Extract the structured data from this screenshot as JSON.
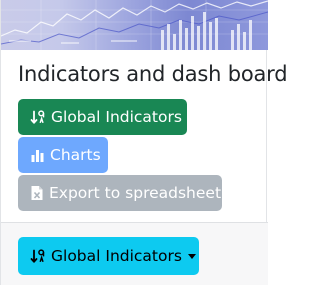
{
  "banner": {
    "image": "stock-market-banner"
  },
  "card": {
    "title": "Indicators and dash board",
    "buttons": {
      "global_indicators": {
        "label": "Global Indicators",
        "icon": "sort-numeric-icon",
        "color": "#198754"
      },
      "charts": {
        "label": "Charts",
        "icon": "bar-chart-icon",
        "color": "#6ea8fe"
      },
      "export": {
        "label": "Export to spreadsheet",
        "icon": "excel-file-icon",
        "color": "#adb5bd"
      }
    }
  },
  "footer": {
    "dropdown": {
      "label": "Global Indicators",
      "icon": "sort-numeric-icon",
      "color": "#0dcaf0",
      "caret": "chevron-down-icon"
    }
  }
}
